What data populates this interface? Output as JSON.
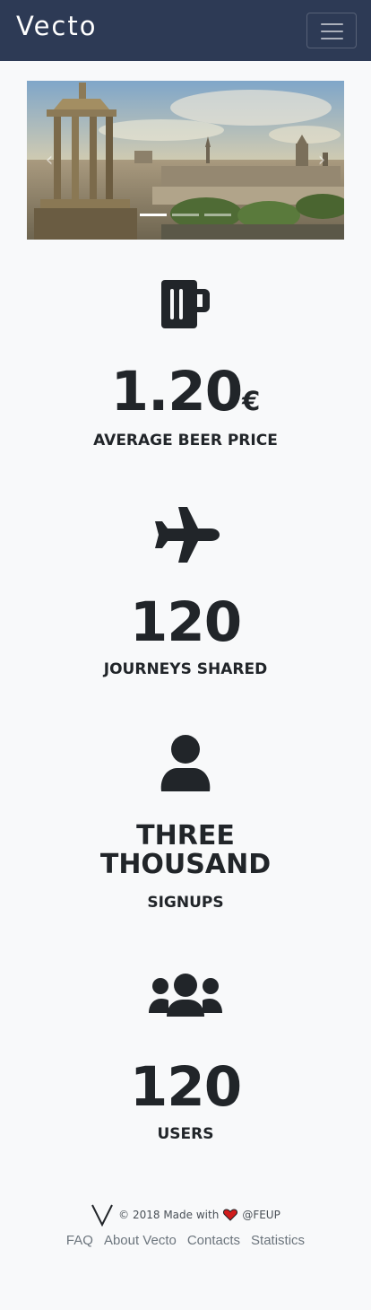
{
  "navbar": {
    "brand": "Vecto",
    "brand_color": "#2d3a55",
    "toggler_icon": "hamburger-icon"
  },
  "carousel": {
    "slide_count": 3,
    "active_index": 0,
    "prev_icon": "chevron-left-icon",
    "next_icon": "chevron-right-icon"
  },
  "stats": [
    {
      "icon": "beer-mug-icon",
      "value": "1.20",
      "unit": "€",
      "label": "AVERAGE BEER PRICE"
    },
    {
      "icon": "airplane-icon",
      "value": "120",
      "label": "JOURNEYS SHARED"
    },
    {
      "icon": "user-icon",
      "value": "THREE THOUSAND",
      "value_lines": [
        "THREE",
        "THOUSAND"
      ],
      "label": "SIGNUPS"
    },
    {
      "icon": "users-icon",
      "value": "120",
      "label": "USERS"
    }
  ],
  "footer": {
    "logo_icon": "vecto-logo-icon",
    "copyright": "© 2018 Made with",
    "heart_icon": "heart-icon",
    "heart_color": "#d01c1c",
    "org": "@FEUP",
    "links": [
      "FAQ",
      "About Vecto",
      "Contacts",
      "Statistics"
    ]
  }
}
